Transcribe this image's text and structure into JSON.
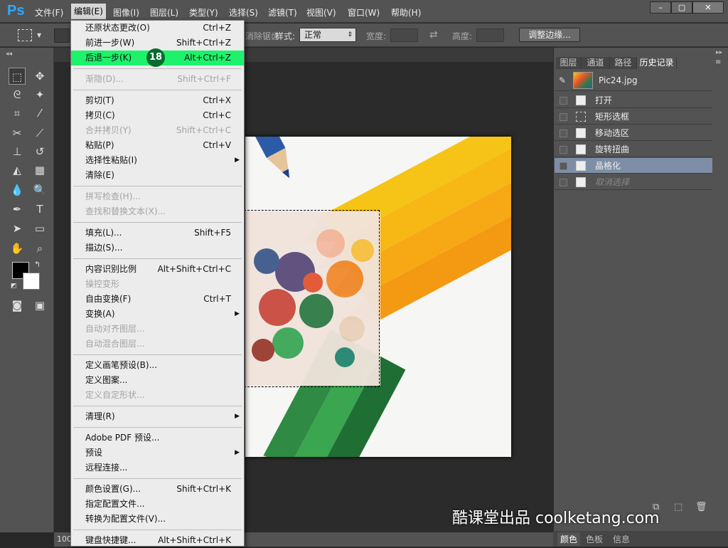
{
  "app": {
    "logo": "Ps"
  },
  "menubar": {
    "items": [
      "文件(F)",
      "编辑(E)",
      "图像(I)",
      "图层(L)",
      "类型(Y)",
      "选择(S)",
      "滤镜(T)",
      "视图(V)",
      "窗口(W)",
      "帮助(H)"
    ],
    "active_index": 1
  },
  "options_bar": {
    "style_label": "样式:",
    "style_value": "正常",
    "width_label": "宽度:",
    "height_label": "高度:",
    "refine_button": "调整边缘...",
    "partial_label": "消除锯齿"
  },
  "edit_menu": {
    "groups": [
      [
        {
          "label": "还原状态更改(O)",
          "shortcut": "Ctrl+Z",
          "disabled": false
        },
        {
          "label": "前进一步(W)",
          "shortcut": "Shift+Ctrl+Z",
          "disabled": false
        },
        {
          "label": "后退一步(K)",
          "shortcut": "Alt+Ctrl+Z",
          "disabled": false,
          "highlighted": true
        }
      ],
      [
        {
          "label": "渐隐(D)...",
          "shortcut": "Shift+Ctrl+F",
          "disabled": true
        }
      ],
      [
        {
          "label": "剪切(T)",
          "shortcut": "Ctrl+X",
          "disabled": false
        },
        {
          "label": "拷贝(C)",
          "shortcut": "Ctrl+C",
          "disabled": false
        },
        {
          "label": "合并拷贝(Y)",
          "shortcut": "Shift+Ctrl+C",
          "disabled": true
        },
        {
          "label": "粘贴(P)",
          "shortcut": "Ctrl+V",
          "disabled": false
        },
        {
          "label": "选择性粘贴(I)",
          "shortcut": "",
          "disabled": false,
          "submenu": true
        },
        {
          "label": "清除(E)",
          "shortcut": "",
          "disabled": false
        }
      ],
      [
        {
          "label": "拼写检查(H)...",
          "shortcut": "",
          "disabled": true
        },
        {
          "label": "查找和替换文本(X)...",
          "shortcut": "",
          "disabled": true
        }
      ],
      [
        {
          "label": "填充(L)...",
          "shortcut": "Shift+F5",
          "disabled": false
        },
        {
          "label": "描边(S)...",
          "shortcut": "",
          "disabled": false
        }
      ],
      [
        {
          "label": "内容识别比例",
          "shortcut": "Alt+Shift+Ctrl+C",
          "disabled": false
        },
        {
          "label": "操控变形",
          "shortcut": "",
          "disabled": true
        },
        {
          "label": "自由变换(F)",
          "shortcut": "Ctrl+T",
          "disabled": false
        },
        {
          "label": "变换(A)",
          "shortcut": "",
          "disabled": false,
          "submenu": true
        },
        {
          "label": "自动对齐图层...",
          "shortcut": "",
          "disabled": true
        },
        {
          "label": "自动混合图层...",
          "shortcut": "",
          "disabled": true
        }
      ],
      [
        {
          "label": "定义画笔预设(B)...",
          "shortcut": "",
          "disabled": false
        },
        {
          "label": "定义图案...",
          "shortcut": "",
          "disabled": false
        },
        {
          "label": "定义自定形状...",
          "shortcut": "",
          "disabled": true
        }
      ],
      [
        {
          "label": "清理(R)",
          "shortcut": "",
          "disabled": false,
          "submenu": true
        }
      ],
      [
        {
          "label": "Adobe PDF 预设...",
          "shortcut": "",
          "disabled": false
        },
        {
          "label": "预设",
          "shortcut": "",
          "disabled": false,
          "submenu": true
        },
        {
          "label": "远程连接...",
          "shortcut": "",
          "disabled": false
        }
      ],
      [
        {
          "label": "颜色设置(G)...",
          "shortcut": "Shift+Ctrl+K",
          "disabled": false
        },
        {
          "label": "指定配置文件...",
          "shortcut": "",
          "disabled": false
        },
        {
          "label": "转换为配置文件(V)...",
          "shortcut": "",
          "disabled": false
        }
      ],
      [
        {
          "label": "键盘快捷键...",
          "shortcut": "Alt+Shift+Ctrl+K",
          "disabled": false
        }
      ]
    ]
  },
  "step_badge": "18",
  "panels": {
    "tabs": [
      "图层",
      "通道",
      "路径",
      "历史记录"
    ],
    "active_tab": 3,
    "snapshot_name": "Pic24.jpg",
    "history": [
      {
        "label": "打开",
        "state": "normal"
      },
      {
        "label": "矩形选框",
        "state": "normal"
      },
      {
        "label": "移动选区",
        "state": "normal"
      },
      {
        "label": "旋转扭曲",
        "state": "normal"
      },
      {
        "label": "晶格化",
        "state": "selected"
      },
      {
        "label": "取消选择",
        "state": "undone"
      }
    ],
    "bottom_tabs": [
      "颜色",
      "色板",
      "信息"
    ]
  },
  "status": {
    "zoom": "100"
  },
  "watermark": "酷课堂出品 coolketang.com",
  "colors": {
    "highlight": "#1ef26b",
    "badge": "#0a6b2e",
    "history_selected": "#7d8ea6",
    "logo": "#31a8ff"
  }
}
